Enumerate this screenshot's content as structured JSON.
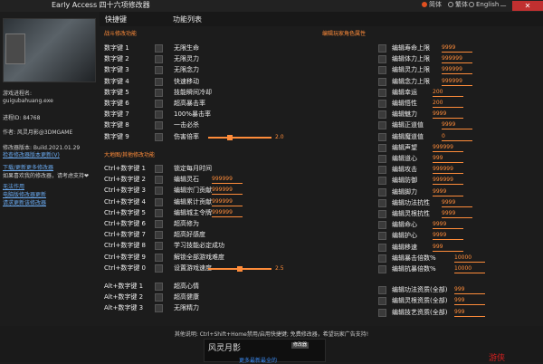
{
  "app": {
    "title": "Early Access 四十六项修改器",
    "lang_options": [
      "简体",
      "繁体",
      "English"
    ],
    "minimize": "—",
    "close": "✕"
  },
  "colors": {
    "accent": "#ff8c3a",
    "link": "#6aaaf0",
    "close": "#c03030"
  },
  "header": {
    "col_hotkey": "快捷键",
    "col_function": "功能列表"
  },
  "left": {
    "logo_text": "",
    "info": [
      "游戏进程名:",
      "guigubahuang.exe",
      "进程ID:  84768",
      "作者: 风灵月影@3DMGAME",
      "修改器版本: Build.2021.01.29",
      "检查修改器版本更新(V)"
    ],
    "links": [
      "下载/更新更多修改器",
      "如果喜欢我的修改器，请考虑支持❤",
      "无法作用",
      "电脑版修改器更新",
      "请求更新该修改器"
    ]
  },
  "sections": {
    "battle": "战斗修改功能",
    "edit_player": "编辑玩家角色属性",
    "map": "大地图/其他修改功能"
  },
  "left_rows": [
    {
      "key": "数字键 1",
      "fn": "无限生命"
    },
    {
      "key": "数字键 2",
      "fn": "无限灵力"
    },
    {
      "key": "数字键 3",
      "fn": "无限念力"
    },
    {
      "key": "数字键 4",
      "fn": "快速移动"
    },
    {
      "key": "数字键 5",
      "fn": "技能瞬间冷却"
    },
    {
      "key": "数字键 6",
      "fn": "超高暴击率"
    },
    {
      "key": "数字键 7",
      "fn": "100%暴击率"
    },
    {
      "key": "数字键 8",
      "fn": "一击必杀"
    },
    {
      "key": "数字键 9",
      "fn": "伤害倍率",
      "slider": "2.0"
    }
  ],
  "map_rows": [
    {
      "key": "Ctrl+数字键 1",
      "fn": "锁定每月时间"
    },
    {
      "key": "Ctrl+数字键 2",
      "fn": "编辑灵石",
      "value": "999999"
    },
    {
      "key": "Ctrl+数字键 3",
      "fn": "编辑宗门贡献",
      "value": "999999"
    },
    {
      "key": "Ctrl+数字键 4",
      "fn": "编辑累计贡献",
      "value": "999999"
    },
    {
      "key": "Ctrl+数字键 5",
      "fn": "编辑城主令牌",
      "value": "999999"
    },
    {
      "key": "Ctrl+数字键 6",
      "fn": "超高修为"
    },
    {
      "key": "Ctrl+数字键 7",
      "fn": "超高好感度"
    },
    {
      "key": "Ctrl+数字键 8",
      "fn": "学习技能必定成功"
    },
    {
      "key": "Ctrl+数字键 9",
      "fn": "解锁全部游戏难度"
    },
    {
      "key": "Ctrl+数字键 0",
      "fn": "设置游戏速度",
      "slider": "2.5"
    }
  ],
  "alt_rows": [
    {
      "key": "Alt+数字键 1",
      "fn": "超高心情"
    },
    {
      "key": "Alt+数字键 2",
      "fn": "超高健康"
    },
    {
      "key": "Alt+数字键 3",
      "fn": "无限精力"
    }
  ],
  "right_rows": [
    {
      "fn": "编辑寿命上限",
      "value": "9999"
    },
    {
      "fn": "编辑体力上限",
      "value": "999999"
    },
    {
      "fn": "编辑灵力上限",
      "value": "999999"
    },
    {
      "fn": "编辑念力上限",
      "value": "999999"
    },
    {
      "fn": "编辑幸运",
      "value": "200"
    },
    {
      "fn": "编辑悟性",
      "value": "200"
    },
    {
      "fn": "编辑魅力",
      "value": "9999"
    },
    {
      "fn": "编辑正道值",
      "value": "9999"
    },
    {
      "fn": "编辑魔道值",
      "value": "0"
    },
    {
      "fn": "编辑声望",
      "value": "999999"
    },
    {
      "fn": "编辑道心",
      "value": "999"
    },
    {
      "fn": "编辑攻击",
      "value": "999999"
    },
    {
      "fn": "编辑防御",
      "value": "999999"
    },
    {
      "fn": "编辑脚力",
      "value": "9999"
    },
    {
      "fn": "编辑功法抗性",
      "value": "9999"
    },
    {
      "fn": "编辑灵根抗性",
      "value": "9999"
    },
    {
      "fn": "编辑命心",
      "value": "9999"
    },
    {
      "fn": "编辑护心",
      "value": "9999"
    },
    {
      "fn": "编辑移速",
      "value": "999"
    },
    {
      "fn": "编辑暴击倍数%",
      "value": "10000"
    },
    {
      "fn": "编辑抗暴倍数%",
      "value": "10000"
    },
    {
      "fn": "编辑功法资质(全部)",
      "value": "999"
    },
    {
      "fn": "编辑灵根资质(全部)",
      "value": "999"
    },
    {
      "fn": "编辑技艺资质(全部)",
      "value": "999"
    }
  ],
  "footer": {
    "text": "其他说明: Ctrl+Shift+Home禁用/启用快捷键; 免费修改器，希望玩家广告支持!",
    "banner_logo": "风灵月影",
    "banner_tag": "修改器",
    "banner_line": "更多最新最全的",
    "corner": "游侠"
  }
}
